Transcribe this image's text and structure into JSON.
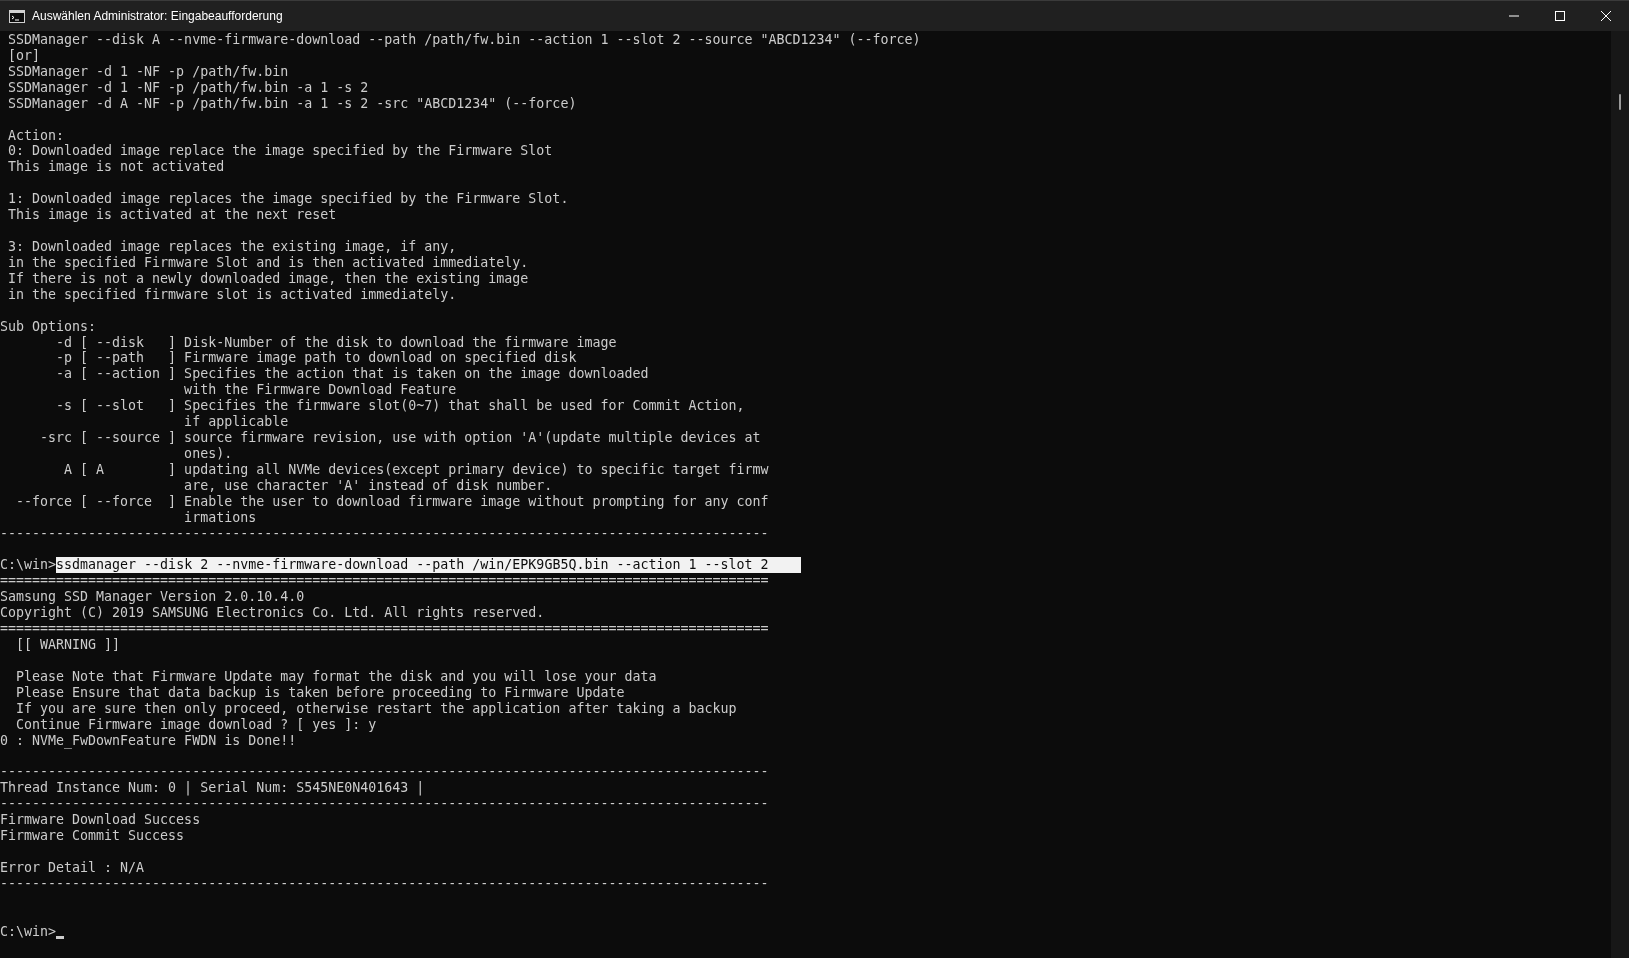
{
  "window": {
    "title": "Auswählen Administrator: Eingabeaufforderung"
  },
  "lines": [
    {
      "kind": "text",
      "text": " SSDManager --disk A --nvme-firmware-download --path /path/fw.bin --action 1 --slot 2 --source \"ABCD1234\" (--force)"
    },
    {
      "kind": "text",
      "text": " [or]"
    },
    {
      "kind": "text",
      "text": " SSDManager -d 1 -NF -p /path/fw.bin"
    },
    {
      "kind": "text",
      "text": " SSDManager -d 1 -NF -p /path/fw.bin -a 1 -s 2"
    },
    {
      "kind": "text",
      "text": " SSDManager -d A -NF -p /path/fw.bin -a 1 -s 2 -src \"ABCD1234\" (--force)"
    },
    {
      "kind": "blank"
    },
    {
      "kind": "text",
      "text": " Action:"
    },
    {
      "kind": "text",
      "text": " 0: Downloaded image replace the image specified by the Firmware Slot"
    },
    {
      "kind": "text",
      "text": " This image is not activated"
    },
    {
      "kind": "blank"
    },
    {
      "kind": "text",
      "text": " 1: Downloaded image replaces the image specified by the Firmware Slot."
    },
    {
      "kind": "text",
      "text": " This image is activated at the next reset"
    },
    {
      "kind": "blank"
    },
    {
      "kind": "text",
      "text": " 3: Downloaded image replaces the existing image, if any,"
    },
    {
      "kind": "text",
      "text": " in the specified Firmware Slot and is then activated immediately."
    },
    {
      "kind": "text",
      "text": " If there is not a newly downloaded image, then the existing image"
    },
    {
      "kind": "text",
      "text": " in the specified firmware slot is activated immediately."
    },
    {
      "kind": "blank"
    },
    {
      "kind": "text",
      "text": "Sub Options:"
    },
    {
      "kind": "text",
      "text": "       -d [ --disk   ] Disk-Number of the disk to download the firmware image"
    },
    {
      "kind": "text",
      "text": "       -p [ --path   ] Firmware image path to download on specified disk"
    },
    {
      "kind": "text",
      "text": "       -a [ --action ] Specifies the action that is taken on the image downloaded"
    },
    {
      "kind": "text",
      "text": "                       with the Firmware Download Feature"
    },
    {
      "kind": "text",
      "text": "       -s [ --slot   ] Specifies the firmware slot(0~7) that shall be used for Commit Action,"
    },
    {
      "kind": "text",
      "text": "                       if applicable"
    },
    {
      "kind": "text",
      "text": "     -src [ --source ] source firmware revision, use with option 'A'(update multiple devices at"
    },
    {
      "kind": "text",
      "text": "                       ones)."
    },
    {
      "kind": "text",
      "text": "        A [ A        ] updating all NVMe devices(except primary device) to specific target firmw"
    },
    {
      "kind": "text",
      "text": "                       are, use character 'A' instead of disk number."
    },
    {
      "kind": "text",
      "text": "  --force [ --force  ] Enable the user to download firmware image without prompting for any conf"
    },
    {
      "kind": "text",
      "text": "                       irmations"
    },
    {
      "kind": "text",
      "text": "------------------------------------------------------------------------------------------------"
    },
    {
      "kind": "blank"
    },
    {
      "kind": "prompt",
      "prompt": "C:\\win>",
      "command": "ssdmanager --disk 2 --nvme-firmware-download --path /win/EPK9GB5Q.bin --action 1 --slot 2",
      "selected": true,
      "cursor": false
    },
    {
      "kind": "text",
      "text": "================================================================================================"
    },
    {
      "kind": "text",
      "text": "Samsung SSD Manager Version 2.0.10.4.0"
    },
    {
      "kind": "text",
      "text": "Copyright (C) 2019 SAMSUNG Electronics Co. Ltd. All rights reserved."
    },
    {
      "kind": "text",
      "text": "================================================================================================"
    },
    {
      "kind": "text",
      "text": "  [[ WARNING ]]"
    },
    {
      "kind": "blank"
    },
    {
      "kind": "text",
      "text": "  Please Note that Firmware Update may format the disk and you will lose your data"
    },
    {
      "kind": "text",
      "text": "  Please Ensure that data backup is taken before proceeding to Firmware Update"
    },
    {
      "kind": "text",
      "text": "  If you are sure then only proceed, otherwise restart the application after taking a backup"
    },
    {
      "kind": "text",
      "text": "  Continue Firmware image download ? [ yes ]: y"
    },
    {
      "kind": "text",
      "text": "0 : NVMe_FwDownFeature FWDN is Done!!"
    },
    {
      "kind": "blank"
    },
    {
      "kind": "text",
      "text": "------------------------------------------------------------------------------------------------"
    },
    {
      "kind": "text",
      "text": "Thread Instance Num: 0 | Serial Num: S545NE0N401643 |"
    },
    {
      "kind": "text",
      "text": "------------------------------------------------------------------------------------------------"
    },
    {
      "kind": "text",
      "text": "Firmware Download Success"
    },
    {
      "kind": "text",
      "text": "Firmware Commit Success"
    },
    {
      "kind": "blank"
    },
    {
      "kind": "text",
      "text": "Error Detail : N/A"
    },
    {
      "kind": "text",
      "text": "------------------------------------------------------------------------------------------------"
    },
    {
      "kind": "blank"
    },
    {
      "kind": "blank"
    },
    {
      "kind": "prompt",
      "prompt": "C:\\win>",
      "cursor": true
    }
  ]
}
